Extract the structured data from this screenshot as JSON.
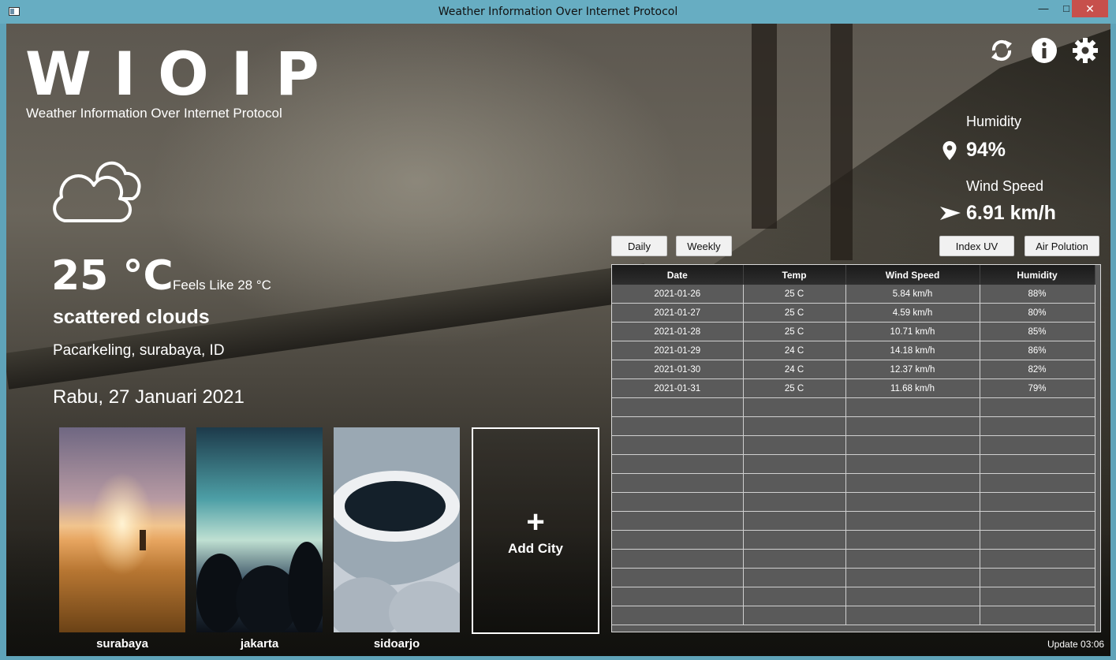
{
  "window": {
    "title": "Weather Information Over Internet Protocol",
    "min_icon": "minimize-icon",
    "max_icon": "maximize-icon",
    "close_icon": "close-icon"
  },
  "brand": {
    "logo": "WIOIP",
    "subtitle": "Weather Information Over Internet Protocol"
  },
  "toolbar": {
    "icons": [
      "refresh-icon",
      "info-icon",
      "settings-icon"
    ]
  },
  "current": {
    "icon": "cloud-icon",
    "temperature": "25 °C",
    "feels_like": "Feels Like 28 °C",
    "description": "scattered clouds",
    "location": "Pacarkeling, surabaya, ID",
    "date": "Rabu, 27 Januari 2021"
  },
  "metrics": {
    "humidity_label": "Humidity",
    "humidity_value": "94%",
    "humidity_icon": "location-pin-icon",
    "wind_label": "Wind Speed",
    "wind_value": "6.91 km/h",
    "wind_icon": "wind-arrow-icon"
  },
  "buttons": {
    "daily": "Daily",
    "weekly": "Weekly",
    "index_uv": "Index UV",
    "air_pollution": "Air Polution"
  },
  "table": {
    "headers": [
      "Date",
      "Temp",
      "Wind Speed",
      "Humidity"
    ],
    "rows": [
      [
        "2021-01-26",
        "25 C",
        "5.84 km/h",
        "88%"
      ],
      [
        "2021-01-27",
        "25 C",
        "4.59 km/h",
        "80%"
      ],
      [
        "2021-01-28",
        "25 C",
        "10.71 km/h",
        "85%"
      ],
      [
        "2021-01-29",
        "24 C",
        "14.18 km/h",
        "86%"
      ],
      [
        "2021-01-30",
        "24 C",
        "12.37 km/h",
        "82%"
      ],
      [
        "2021-01-31",
        "25 C",
        "11.68 km/h",
        "79%"
      ]
    ]
  },
  "cities": [
    {
      "name": "surabaya"
    },
    {
      "name": "jakarta"
    },
    {
      "name": "sidoarjo"
    }
  ],
  "add_city": {
    "plus": "+",
    "label": "Add City"
  },
  "footer": {
    "update": "Update 03:06"
  },
  "colors": {
    "titlebar": "#67adc2",
    "close": "#c7504c",
    "table_bg": "#5a5a5a"
  }
}
